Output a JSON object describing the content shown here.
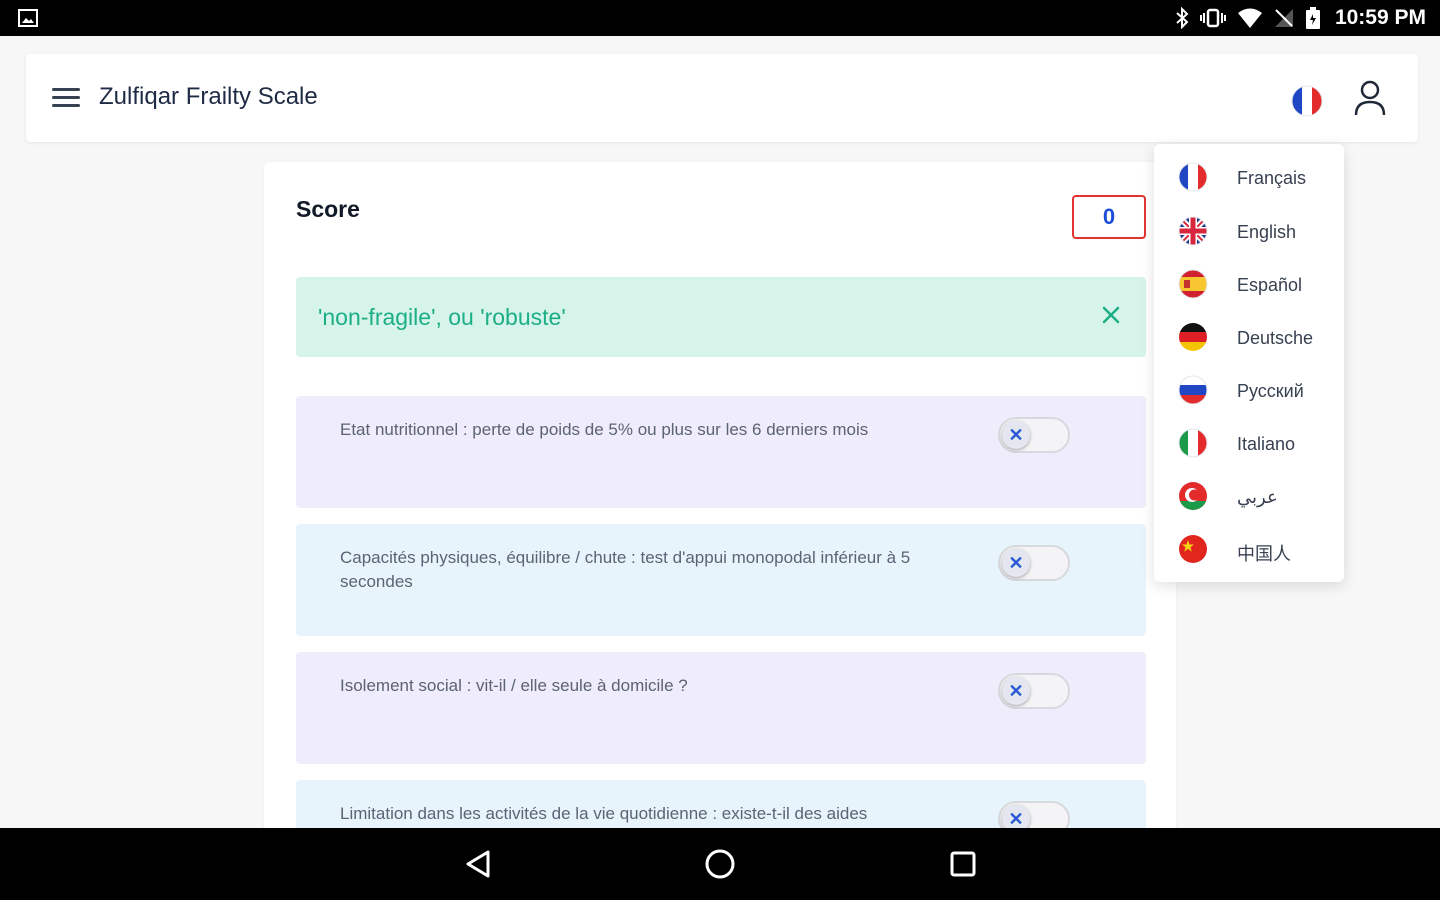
{
  "status_bar": {
    "time": "10:59 PM",
    "icons": [
      "gallery-icon",
      "bluetooth-icon",
      "vibrate-icon",
      "wifi-icon",
      "no-signal-icon",
      "battery-icon"
    ]
  },
  "app_bar": {
    "title": "Zulfiqar Frailty Scale",
    "menu_icon": "hamburger-menu-icon",
    "language_icon": "france-flag-icon",
    "account_icon": "user-icon"
  },
  "score": {
    "label": "Score",
    "value": "0"
  },
  "result": {
    "text": "'non-fragile', ou 'robuste'",
    "close_icon": "close-icon",
    "color": "#1cae85"
  },
  "questions": [
    {
      "text": "Etat nutritionnel : perte de poids de 5% ou plus sur les 6 derniers mois",
      "checked": false
    },
    {
      "text": "Capacités physiques, équilibre / chute : test d'appui monopodal inférieur à 5 secondes",
      "checked": false
    },
    {
      "text": "Isolement social : vit-il / elle seule à domicile ?",
      "checked": false
    },
    {
      "text": "Limitation dans les activités de la vie quotidienne : existe-t-il des aides",
      "checked": false
    }
  ],
  "languages": [
    {
      "label": "Français",
      "flag": "france-flag-icon"
    },
    {
      "label": "English",
      "flag": "uk-flag-icon"
    },
    {
      "label": "Español",
      "flag": "spain-flag-icon"
    },
    {
      "label": "Deutsche",
      "flag": "germany-flag-icon"
    },
    {
      "label": "Русский",
      "flag": "russia-flag-icon"
    },
    {
      "label": "Italiano",
      "flag": "italy-flag-icon"
    },
    {
      "label": "عربي",
      "flag": "arabic-flag-icon"
    },
    {
      "label": "中国人",
      "flag": "china-flag-icon"
    }
  ],
  "nav_bar": {
    "back": "back-icon",
    "home": "home-icon",
    "recents": "recents-icon"
  }
}
